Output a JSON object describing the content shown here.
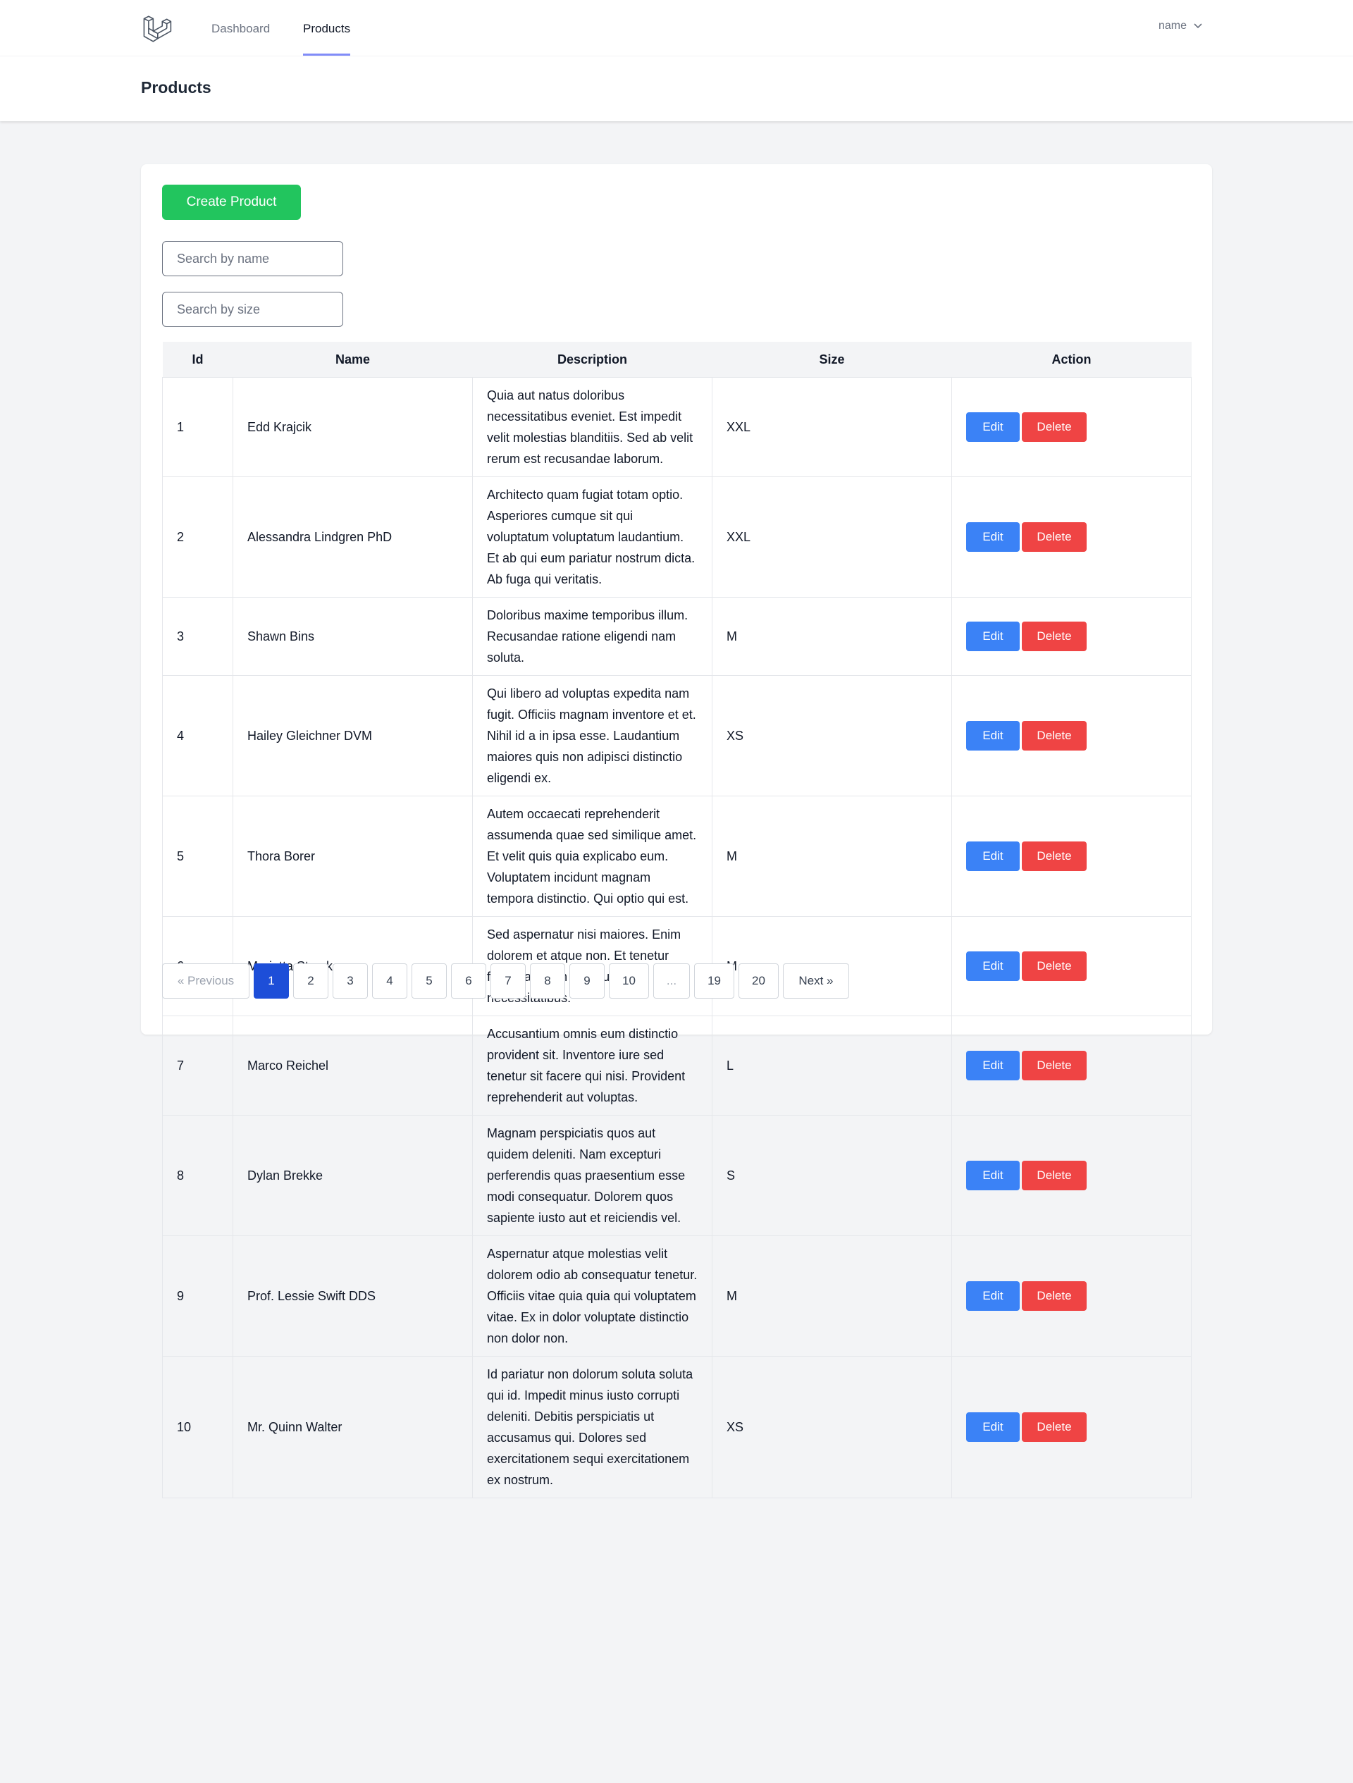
{
  "nav": {
    "links": [
      "Dashboard",
      "Products"
    ],
    "user_name": "name"
  },
  "header": {
    "title": "Products"
  },
  "create_button_label": "Create Product",
  "search": {
    "name_placeholder": "Search by name",
    "size_placeholder": "Search by size"
  },
  "table": {
    "columns": [
      "Id",
      "Name",
      "Description",
      "Size",
      "Action"
    ],
    "edit_label": "Edit",
    "delete_label": "Delete",
    "rows": [
      {
        "id": "1",
        "name": "Edd Krajcik",
        "description": "Quia aut natus doloribus necessitatibus eveniet. Est impedit velit molestias blanditiis. Sed ab velit rerum est recusandae laborum.",
        "size": "XXL"
      },
      {
        "id": "2",
        "name": "Alessandra Lindgren PhD",
        "description": "Architecto quam fugiat totam optio. Asperiores cumque sit qui voluptatum voluptatum laudantium. Et ab qui eum pariatur nostrum dicta. Ab fuga qui veritatis.",
        "size": "XXL"
      },
      {
        "id": "3",
        "name": "Shawn Bins",
        "description": "Doloribus maxime temporibus illum. Recusandae ratione eligendi nam soluta.",
        "size": "M"
      },
      {
        "id": "4",
        "name": "Hailey Gleichner DVM",
        "description": "Qui libero ad voluptas expedita nam fugit. Officiis magnam inventore et et. Nihil id a in ipsa esse. Laudantium maiores quis non adipisci distinctio eligendi ex.",
        "size": "XS"
      },
      {
        "id": "5",
        "name": "Thora Borer",
        "description": "Autem occaecati reprehenderit assumenda quae sed similique amet. Et velit quis quia explicabo eum. Voluptatem incidunt magnam tempora distinctio. Qui optio qui est.",
        "size": "M"
      },
      {
        "id": "6",
        "name": "Marietta Stracke",
        "description": "Sed aspernatur nisi maiores. Enim dolorem et atque non. Et tenetur fugiat laborum deserunt aut necessitatibus.",
        "size": "M"
      },
      {
        "id": "7",
        "name": "Marco Reichel",
        "description": "Accusantium omnis eum distinctio provident sit. Inventore iure sed tenetur sit facere qui nisi. Provident reprehenderit aut voluptas.",
        "size": "L"
      },
      {
        "id": "8",
        "name": "Dylan Brekke",
        "description": "Magnam perspiciatis quos aut quidem deleniti. Nam excepturi perferendis quas praesentium esse modi consequatur. Dolorem quos sapiente iusto aut et reiciendis vel.",
        "size": "S"
      },
      {
        "id": "9",
        "name": "Prof. Lessie Swift DDS",
        "description": "Aspernatur atque molestias velit dolorem odio ab consequatur tenetur. Officiis vitae quia quia qui voluptatem vitae. Ex in dolor voluptate distinctio non dolor non.",
        "size": "M"
      },
      {
        "id": "10",
        "name": "Mr. Quinn Walter",
        "description": "Id pariatur non dolorum soluta soluta qui id. Impedit minus iusto corrupti deleniti. Debitis perspiciatis ut accusamus qui. Dolores sed exercitationem sequi exercitationem ex nostrum.",
        "size": "XS"
      }
    ]
  },
  "pagination": {
    "previous_label": "« Previous",
    "next_label": "Next »",
    "pages": [
      "1",
      "2",
      "3",
      "4",
      "5",
      "6",
      "7",
      "8",
      "9",
      "10",
      "...",
      "19",
      "20"
    ],
    "current": "1"
  },
  "colors": {
    "create_button": "#22c55e",
    "edit_button": "#3b82f6",
    "delete_button": "#ef4444",
    "active_page": "#1d4ed8",
    "nav_active_underline": "#818cf8"
  }
}
